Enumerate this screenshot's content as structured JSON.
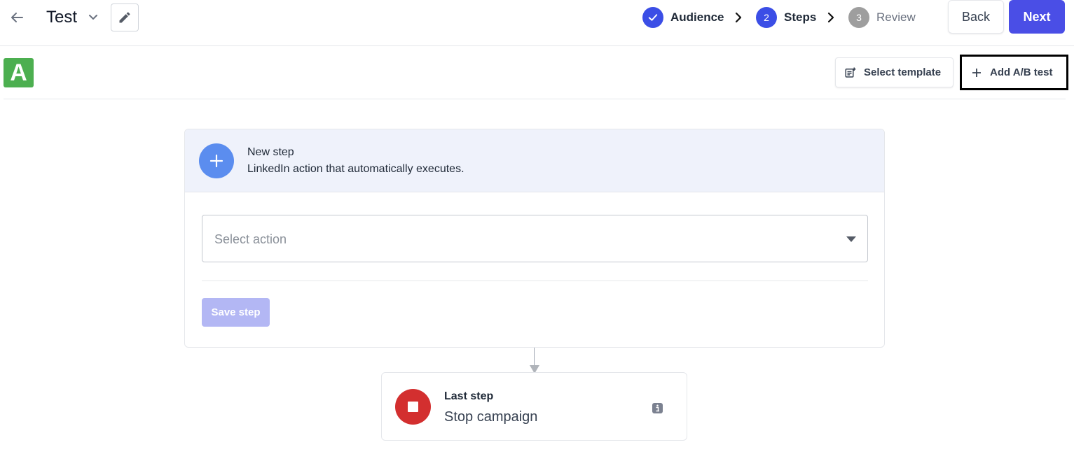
{
  "header": {
    "title": "Test",
    "back_icon": "arrow-left-icon",
    "chevron_icon": "chevron-down-icon",
    "edit_icon": "pencil-icon"
  },
  "stepper": {
    "steps": [
      {
        "number": "",
        "label": "Audience",
        "state": "completed",
        "color": "#3b4ee6"
      },
      {
        "number": "2",
        "label": "Steps",
        "state": "active",
        "color": "#3b4ee6"
      },
      {
        "number": "3",
        "label": "Review",
        "state": "pending",
        "color": "#9e9e9e"
      }
    ]
  },
  "actions": {
    "back_label": "Back",
    "next_label": "Next"
  },
  "variant": {
    "label": "A",
    "color": "#4caf50"
  },
  "toolbar": {
    "select_template_label": "Select template",
    "add_ab_test_label": "Add A/B test"
  },
  "new_step": {
    "title": "New step",
    "subtitle": "LinkedIn action that automatically executes.",
    "select_placeholder": "Select action",
    "save_label": "Save step"
  },
  "last_step": {
    "title": "Last step",
    "subtitle": "Stop campaign"
  },
  "colors": {
    "primary": "#4a4ee6",
    "stop_red": "#d32f2f",
    "step_accent": "#5b8def"
  }
}
